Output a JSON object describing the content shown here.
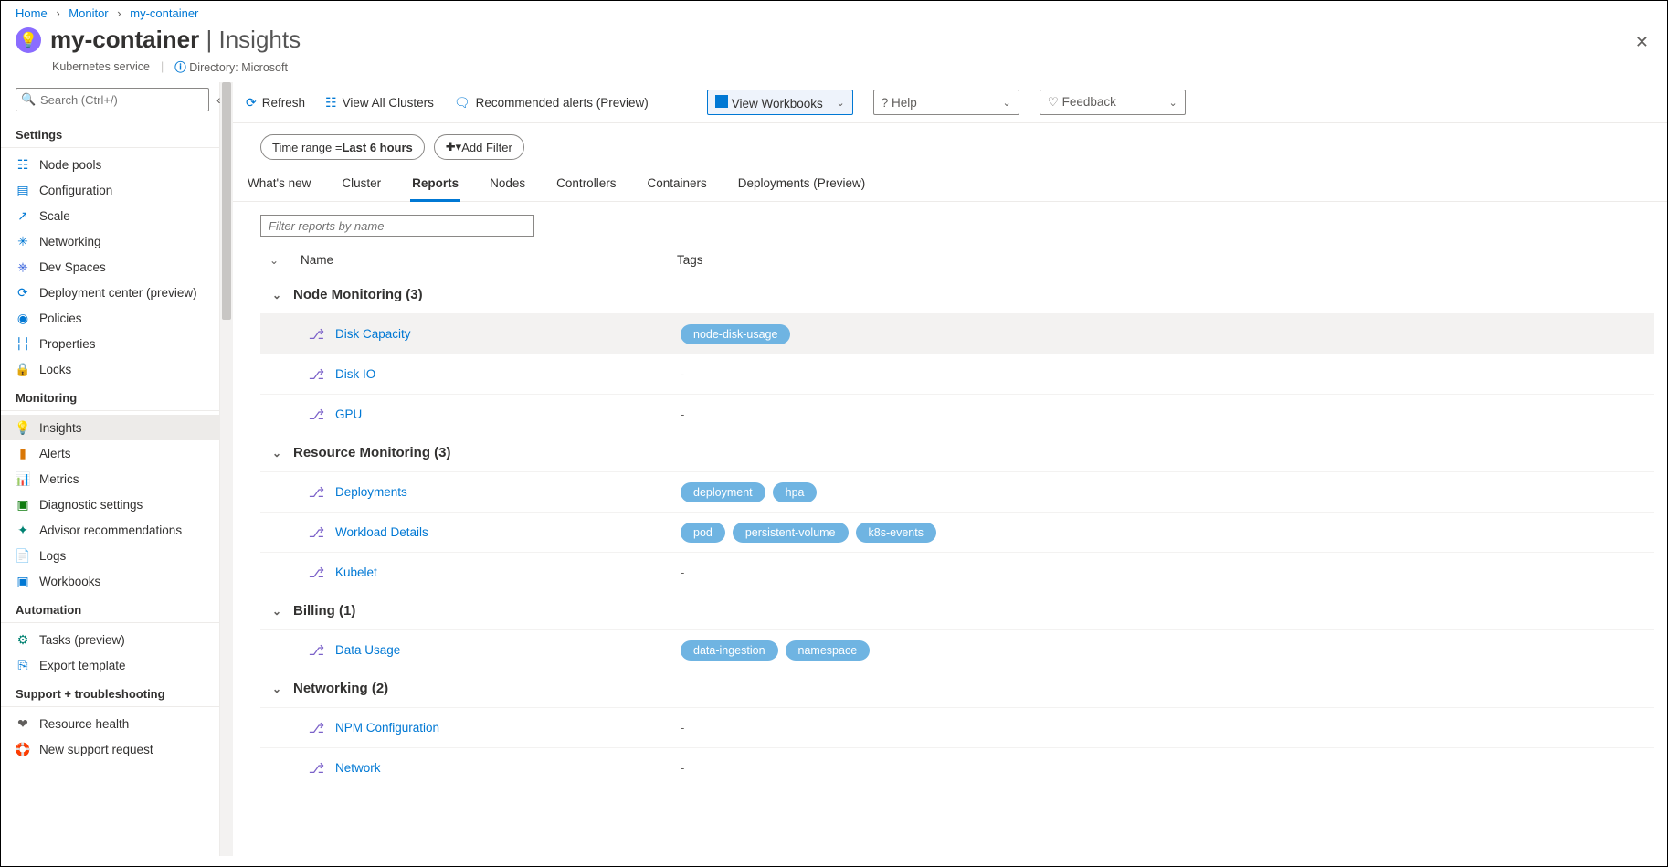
{
  "breadcrumb": {
    "home": "Home",
    "monitor": "Monitor",
    "current": "my-container"
  },
  "header": {
    "title_main": "my-container",
    "title_section": "Insights",
    "subtitle": "Kubernetes service",
    "directory": "Directory: Microsoft"
  },
  "search": {
    "placeholder": "Search (Ctrl+/)"
  },
  "toolbar": {
    "refresh": "Refresh",
    "view_all": "View All Clusters",
    "recommended": "Recommended alerts (Preview)",
    "workbooks": "View Workbooks",
    "help": "Help",
    "feedback": "Feedback"
  },
  "filters": {
    "time_label": "Time range = ",
    "time_value": "Last 6 hours",
    "add_filter": "Add Filter"
  },
  "tabs": {
    "whatsnew": "What's new",
    "cluster": "Cluster",
    "reports": "Reports",
    "nodes": "Nodes",
    "controllers": "Controllers",
    "containers": "Containers",
    "deployments": "Deployments (Preview)"
  },
  "panel": {
    "filter_placeholder": "Filter reports by name",
    "col_name": "Name",
    "col_tags": "Tags"
  },
  "groups": [
    {
      "title": "Node Monitoring (3)",
      "items": [
        {
          "name": "Disk Capacity",
          "tags": [
            "node-disk-usage"
          ],
          "hover": true
        },
        {
          "name": "Disk IO",
          "tags": []
        },
        {
          "name": "GPU",
          "tags": []
        }
      ]
    },
    {
      "title": "Resource Monitoring (3)",
      "items": [
        {
          "name": "Deployments",
          "tags": [
            "deployment",
            "hpa"
          ]
        },
        {
          "name": "Workload Details",
          "tags": [
            "pod",
            "persistent-volume",
            "k8s-events"
          ]
        },
        {
          "name": "Kubelet",
          "tags": []
        }
      ]
    },
    {
      "title": "Billing (1)",
      "items": [
        {
          "name": "Data Usage",
          "tags": [
            "data-ingestion",
            "namespace"
          ]
        }
      ]
    },
    {
      "title": "Networking (2)",
      "items": [
        {
          "name": "NPM Configuration",
          "tags": []
        },
        {
          "name": "Network",
          "tags": []
        }
      ]
    }
  ],
  "sidebar": {
    "groups": [
      {
        "title": "Settings",
        "items": [
          {
            "label": "Node pools",
            "icon": "☷",
            "cls": "c-blue"
          },
          {
            "label": "Configuration",
            "icon": "▤",
            "cls": "c-blue"
          },
          {
            "label": "Scale",
            "icon": "↗",
            "cls": "c-blue"
          },
          {
            "label": "Networking",
            "icon": "✳",
            "cls": "c-blue"
          },
          {
            "label": "Dev Spaces",
            "icon": "⎈",
            "cls": "c-navy"
          },
          {
            "label": "Deployment center (preview)",
            "icon": "⟳",
            "cls": "c-blue"
          },
          {
            "label": "Policies",
            "icon": "◉",
            "cls": "c-blue"
          },
          {
            "label": "Properties",
            "icon": "╎╎",
            "cls": "c-blue"
          },
          {
            "label": "Locks",
            "icon": "🔒",
            "cls": "c-blue"
          }
        ]
      },
      {
        "title": "Monitoring",
        "items": [
          {
            "label": "Insights",
            "icon": "💡",
            "cls": "c-purple",
            "active": true
          },
          {
            "label": "Alerts",
            "icon": "▮",
            "cls": "c-orange"
          },
          {
            "label": "Metrics",
            "icon": "📊",
            "cls": "c-blue"
          },
          {
            "label": "Diagnostic settings",
            "icon": "▣",
            "cls": "c-green"
          },
          {
            "label": "Advisor recommendations",
            "icon": "✦",
            "cls": "c-teal"
          },
          {
            "label": "Logs",
            "icon": "📄",
            "cls": "c-orange"
          },
          {
            "label": "Workbooks",
            "icon": "▣",
            "cls": "c-blue"
          }
        ]
      },
      {
        "title": "Automation",
        "items": [
          {
            "label": "Tasks (preview)",
            "icon": "⚙",
            "cls": "c-teal"
          },
          {
            "label": "Export template",
            "icon": "⎘",
            "cls": "c-blue"
          }
        ]
      },
      {
        "title": "Support + troubleshooting",
        "items": [
          {
            "label": "Resource health",
            "icon": "❤",
            "cls": "c-gray"
          },
          {
            "label": "New support request",
            "icon": "🛟",
            "cls": "c-blue"
          }
        ]
      }
    ]
  }
}
